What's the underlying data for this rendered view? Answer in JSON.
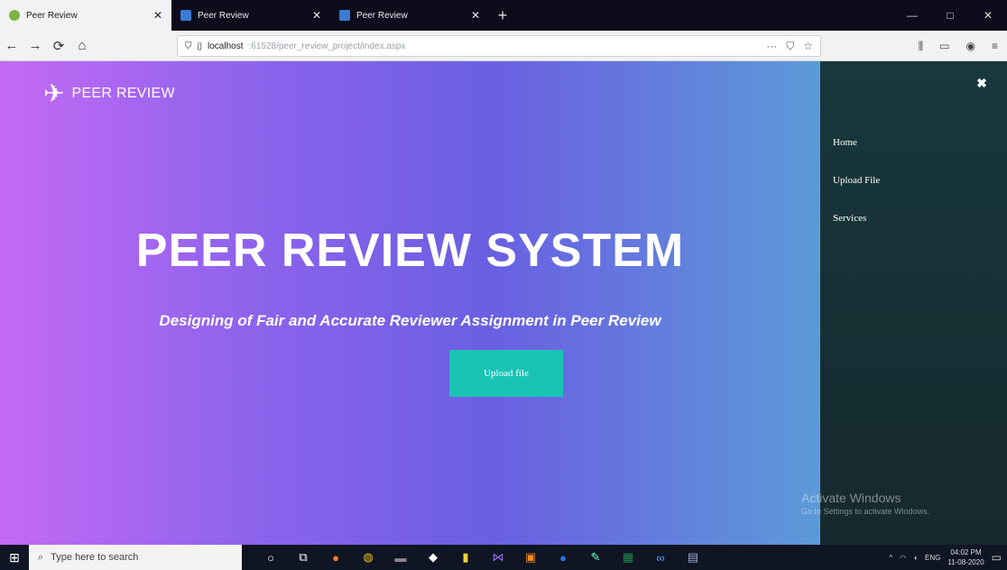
{
  "tabs": [
    {
      "label": "Peer Review",
      "active": true
    },
    {
      "label": "Peer Review",
      "active": false
    },
    {
      "label": "Peer Review",
      "active": false
    }
  ],
  "window_controls": {
    "minimize": "—",
    "maximize": "□",
    "close": "✕"
  },
  "nav": {
    "back": "←",
    "forward": "→",
    "reload": "⟳",
    "home": "⌂",
    "url_host": "localhost",
    "url_path": ":61528/peer_review_project/index.aspx",
    "more": "···",
    "pocket": "⛉",
    "star": "☆"
  },
  "toolbar_right": {
    "library": "⫼",
    "sidebar": "▭",
    "account": "◉",
    "menu": "≡"
  },
  "hero": {
    "brand": "PEER REVIEW",
    "plane_icon": "✈",
    "title": "PEER REVIEW SYSTEM",
    "subtitle": "Designing of Fair and Accurate Reviewer Assignment in Peer Review",
    "button_label": "Upload file"
  },
  "sidebar": {
    "close_label": "✖",
    "items": [
      {
        "label": "Home"
      },
      {
        "label": "Upload File"
      },
      {
        "label": "Services"
      }
    ]
  },
  "watermark": {
    "line1": "Activate Windows",
    "line2": "Go to Settings to activate Windows."
  },
  "taskbar": {
    "start": "⊞",
    "search_icon": "⌕",
    "search_placeholder": "Type here to search",
    "time": "04:02 PM",
    "date": "11-08-2020",
    "lang": "ENG"
  },
  "colors": {
    "gradient_start": "#c46af5",
    "gradient_end": "#5c9ad8",
    "button": "#19c4b5",
    "sidebar": "#17383c"
  }
}
